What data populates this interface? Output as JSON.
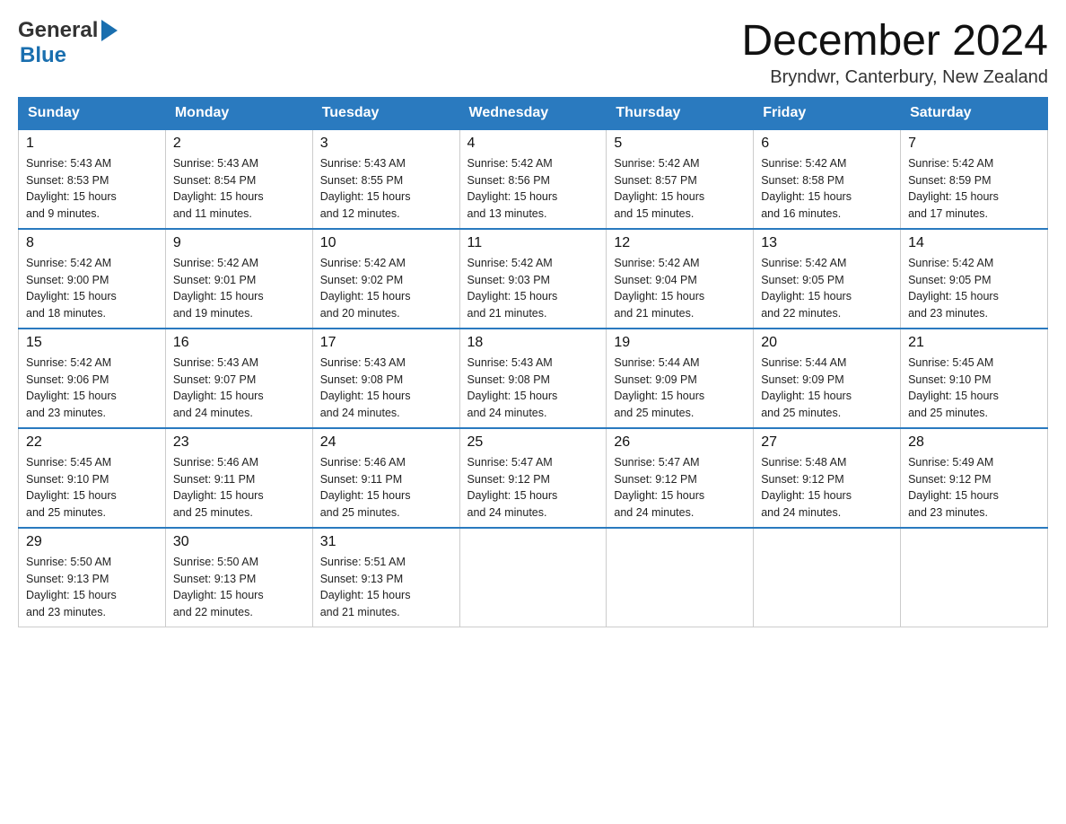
{
  "header": {
    "logo_general": "General",
    "logo_blue": "Blue",
    "month_title": "December 2024",
    "location": "Bryndwr, Canterbury, New Zealand"
  },
  "days_of_week": [
    "Sunday",
    "Monday",
    "Tuesday",
    "Wednesday",
    "Thursday",
    "Friday",
    "Saturday"
  ],
  "weeks": [
    [
      {
        "day": "1",
        "sunrise": "5:43 AM",
        "sunset": "8:53 PM",
        "daylight": "15 hours and 9 minutes."
      },
      {
        "day": "2",
        "sunrise": "5:43 AM",
        "sunset": "8:54 PM",
        "daylight": "15 hours and 11 minutes."
      },
      {
        "day": "3",
        "sunrise": "5:43 AM",
        "sunset": "8:55 PM",
        "daylight": "15 hours and 12 minutes."
      },
      {
        "day": "4",
        "sunrise": "5:42 AM",
        "sunset": "8:56 PM",
        "daylight": "15 hours and 13 minutes."
      },
      {
        "day": "5",
        "sunrise": "5:42 AM",
        "sunset": "8:57 PM",
        "daylight": "15 hours and 15 minutes."
      },
      {
        "day": "6",
        "sunrise": "5:42 AM",
        "sunset": "8:58 PM",
        "daylight": "15 hours and 16 minutes."
      },
      {
        "day": "7",
        "sunrise": "5:42 AM",
        "sunset": "8:59 PM",
        "daylight": "15 hours and 17 minutes."
      }
    ],
    [
      {
        "day": "8",
        "sunrise": "5:42 AM",
        "sunset": "9:00 PM",
        "daylight": "15 hours and 18 minutes."
      },
      {
        "day": "9",
        "sunrise": "5:42 AM",
        "sunset": "9:01 PM",
        "daylight": "15 hours and 19 minutes."
      },
      {
        "day": "10",
        "sunrise": "5:42 AM",
        "sunset": "9:02 PM",
        "daylight": "15 hours and 20 minutes."
      },
      {
        "day": "11",
        "sunrise": "5:42 AM",
        "sunset": "9:03 PM",
        "daylight": "15 hours and 21 minutes."
      },
      {
        "day": "12",
        "sunrise": "5:42 AM",
        "sunset": "9:04 PM",
        "daylight": "15 hours and 21 minutes."
      },
      {
        "day": "13",
        "sunrise": "5:42 AM",
        "sunset": "9:05 PM",
        "daylight": "15 hours and 22 minutes."
      },
      {
        "day": "14",
        "sunrise": "5:42 AM",
        "sunset": "9:05 PM",
        "daylight": "15 hours and 23 minutes."
      }
    ],
    [
      {
        "day": "15",
        "sunrise": "5:42 AM",
        "sunset": "9:06 PM",
        "daylight": "15 hours and 23 minutes."
      },
      {
        "day": "16",
        "sunrise": "5:43 AM",
        "sunset": "9:07 PM",
        "daylight": "15 hours and 24 minutes."
      },
      {
        "day": "17",
        "sunrise": "5:43 AM",
        "sunset": "9:08 PM",
        "daylight": "15 hours and 24 minutes."
      },
      {
        "day": "18",
        "sunrise": "5:43 AM",
        "sunset": "9:08 PM",
        "daylight": "15 hours and 24 minutes."
      },
      {
        "day": "19",
        "sunrise": "5:44 AM",
        "sunset": "9:09 PM",
        "daylight": "15 hours and 25 minutes."
      },
      {
        "day": "20",
        "sunrise": "5:44 AM",
        "sunset": "9:09 PM",
        "daylight": "15 hours and 25 minutes."
      },
      {
        "day": "21",
        "sunrise": "5:45 AM",
        "sunset": "9:10 PM",
        "daylight": "15 hours and 25 minutes."
      }
    ],
    [
      {
        "day": "22",
        "sunrise": "5:45 AM",
        "sunset": "9:10 PM",
        "daylight": "15 hours and 25 minutes."
      },
      {
        "day": "23",
        "sunrise": "5:46 AM",
        "sunset": "9:11 PM",
        "daylight": "15 hours and 25 minutes."
      },
      {
        "day": "24",
        "sunrise": "5:46 AM",
        "sunset": "9:11 PM",
        "daylight": "15 hours and 25 minutes."
      },
      {
        "day": "25",
        "sunrise": "5:47 AM",
        "sunset": "9:12 PM",
        "daylight": "15 hours and 24 minutes."
      },
      {
        "day": "26",
        "sunrise": "5:47 AM",
        "sunset": "9:12 PM",
        "daylight": "15 hours and 24 minutes."
      },
      {
        "day": "27",
        "sunrise": "5:48 AM",
        "sunset": "9:12 PM",
        "daylight": "15 hours and 24 minutes."
      },
      {
        "day": "28",
        "sunrise": "5:49 AM",
        "sunset": "9:12 PM",
        "daylight": "15 hours and 23 minutes."
      }
    ],
    [
      {
        "day": "29",
        "sunrise": "5:50 AM",
        "sunset": "9:13 PM",
        "daylight": "15 hours and 23 minutes."
      },
      {
        "day": "30",
        "sunrise": "5:50 AM",
        "sunset": "9:13 PM",
        "daylight": "15 hours and 22 minutes."
      },
      {
        "day": "31",
        "sunrise": "5:51 AM",
        "sunset": "9:13 PM",
        "daylight": "15 hours and 21 minutes."
      },
      null,
      null,
      null,
      null
    ]
  ],
  "labels": {
    "sunrise": "Sunrise:",
    "sunset": "Sunset:",
    "daylight": "Daylight: 15 hours"
  }
}
